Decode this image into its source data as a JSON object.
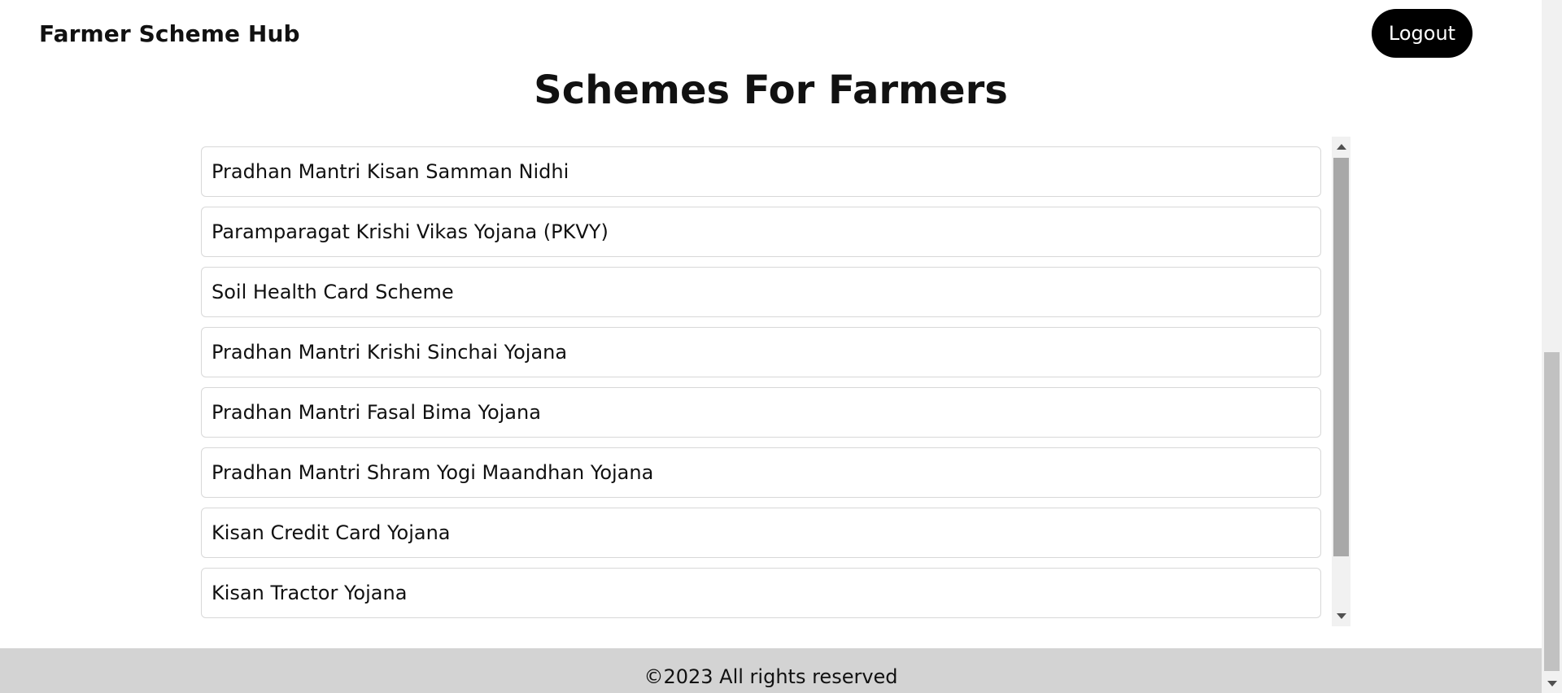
{
  "header": {
    "brand": "Farmer Scheme Hub",
    "logout_label": "Logout"
  },
  "main": {
    "title": "Schemes For Farmers",
    "schemes": [
      "Pradhan Mantri Kisan Samman Nidhi",
      "Paramparagat Krishi Vikas Yojana (PKVY)",
      "Soil Health Card Scheme",
      "Pradhan Mantri Krishi Sinchai Yojana",
      "Pradhan Mantri Fasal Bima Yojana",
      "Pradhan Mantri Shram Yogi Maandhan Yojana",
      "Kisan Credit Card Yojana",
      "Kisan Tractor Yojana"
    ]
  },
  "footer": {
    "text": "©2023 All rights reserved"
  },
  "colors": {
    "logout_bg": "#000000",
    "footer_bg": "#d3d3d3",
    "item_border": "#d8d8d8"
  },
  "icons": {
    "scroll_up": "scroll-up-arrow-icon",
    "scroll_down": "scroll-down-arrow-icon"
  }
}
